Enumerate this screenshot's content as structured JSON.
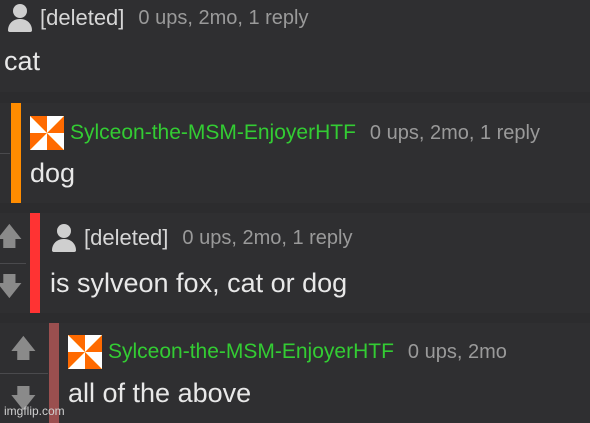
{
  "comments": [
    {
      "user": "[deleted]",
      "meta": "0 ups, 2mo, 1 reply",
      "text": "cat"
    },
    {
      "user": "Sylceon-the-MSM-EnjoyerHTF",
      "meta": "0 ups, 2mo, 1 reply",
      "text": "dog"
    },
    {
      "user": "[deleted]",
      "meta": "0 ups, 2mo, 1 reply",
      "text": "is sylveon fox, cat or dog"
    },
    {
      "user": "Sylceon-the-MSM-EnjoyerHTF",
      "meta": "0 ups, 2mo",
      "text": "all of the above"
    }
  ],
  "icons": {
    "upvote": "up-arrow-icon",
    "downvote": "down-arrow-icon",
    "deleted_avatar": "person-icon",
    "user_avatar": "pinwheel-icon"
  },
  "colors": {
    "username": "#33cc33",
    "bar_level2": "#ff8c00",
    "bar_level3": "#ff3333",
    "bar_level4": "#9a4f4f"
  },
  "watermark": "imgflip.com"
}
